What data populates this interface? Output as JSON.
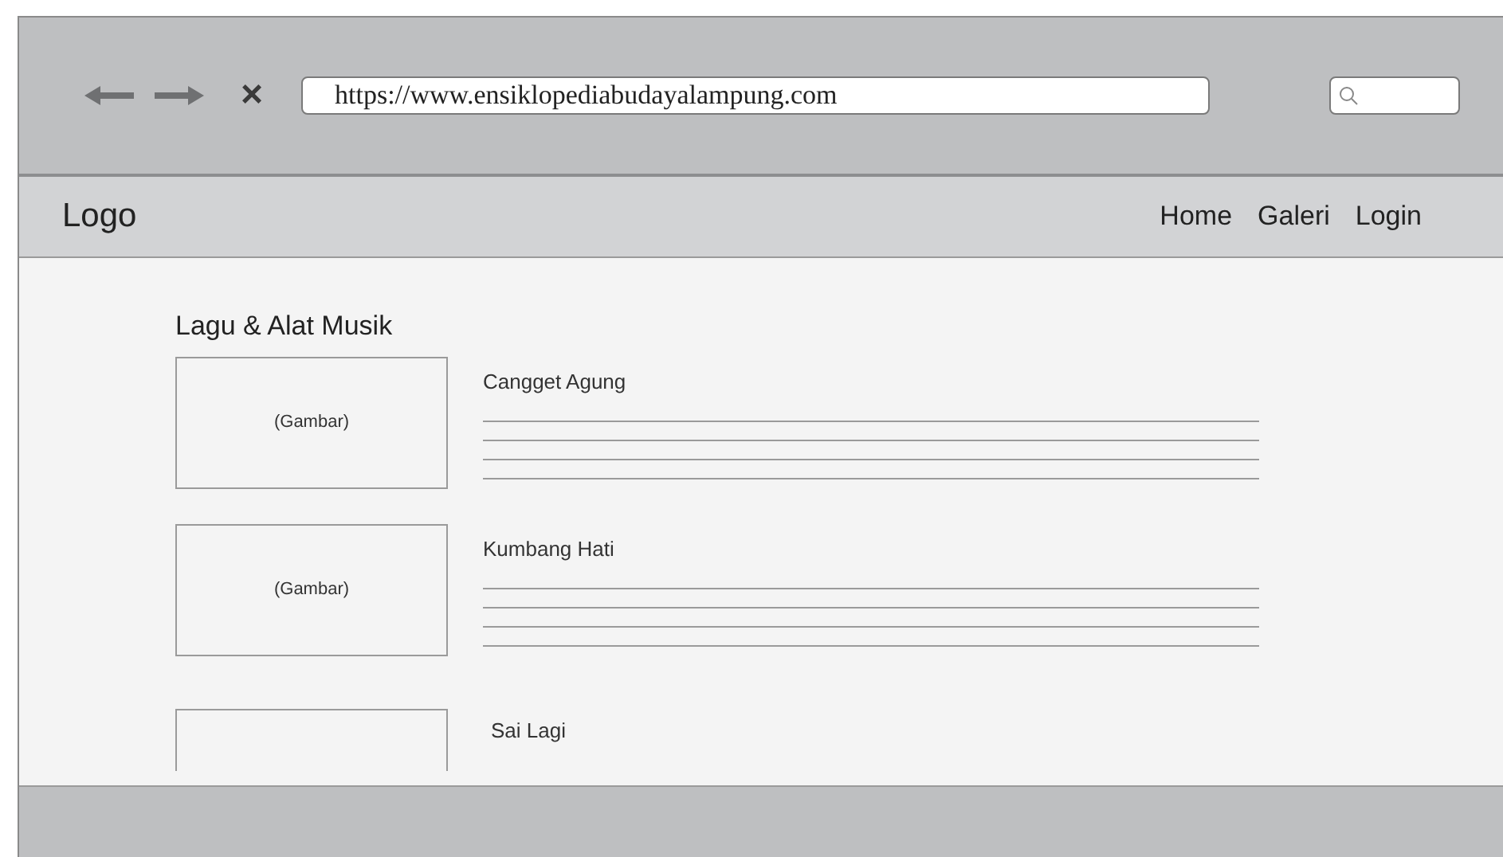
{
  "browser": {
    "url": "https://www.ensiklopediabudayalampung.com",
    "close_glyph": "×"
  },
  "navbar": {
    "logo": "Logo",
    "links": [
      "Home",
      "Galeri",
      "Login"
    ]
  },
  "section": {
    "heading": "Lagu & Alat Musik",
    "items": [
      {
        "kind": "full",
        "title": "Cangget Agung",
        "image_label": "(Gambar)"
      },
      {
        "kind": "full",
        "title": "Kumbang Hati",
        "image_label": "(Gambar)"
      },
      {
        "kind": "cut",
        "title": "Sai Lagi"
      }
    ]
  }
}
